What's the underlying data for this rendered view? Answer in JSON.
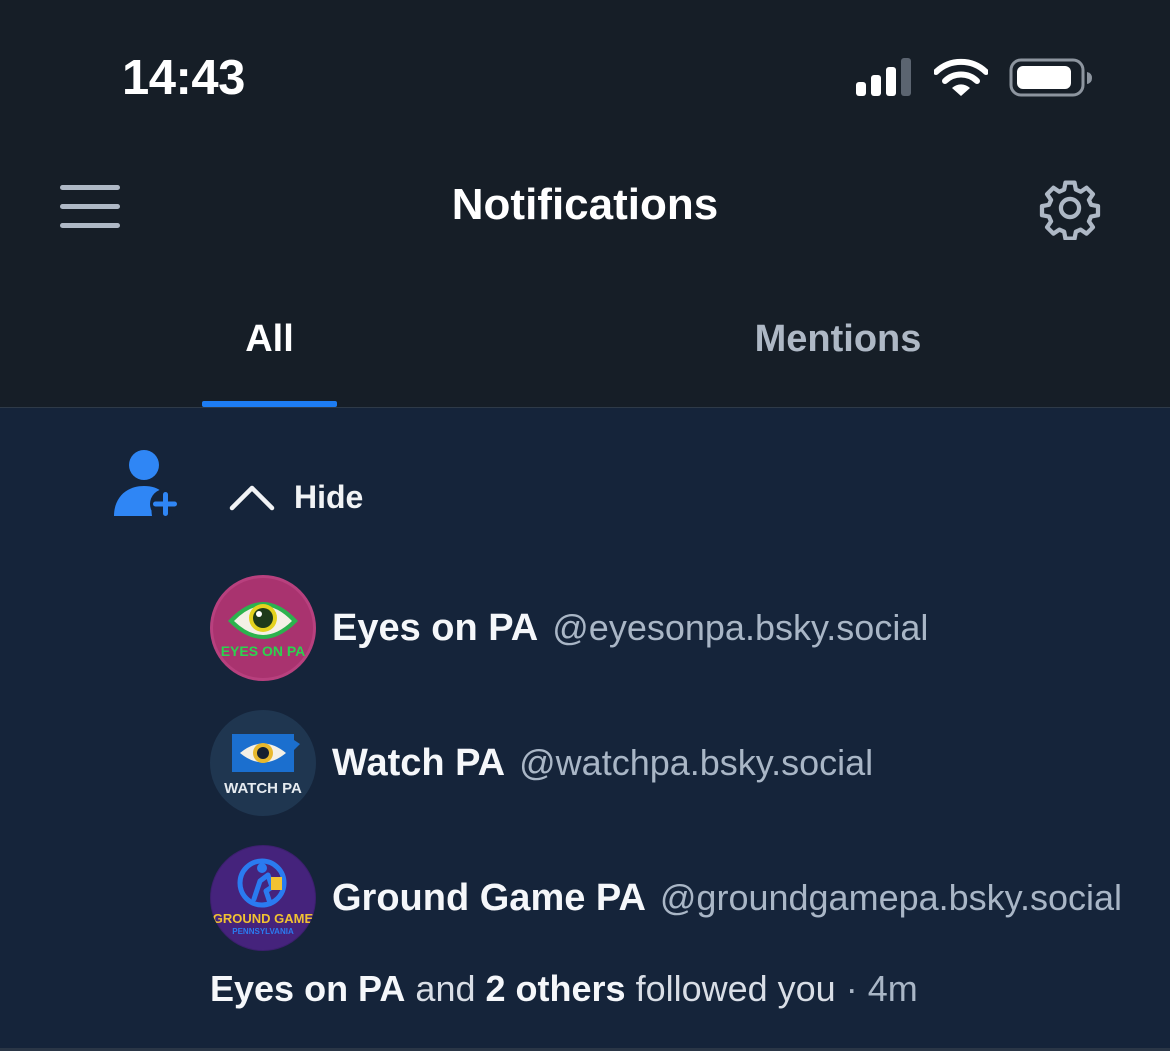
{
  "status_bar": {
    "time": "14:43"
  },
  "header": {
    "title": "Notifications"
  },
  "tabs": [
    {
      "label": "All",
      "active": true
    },
    {
      "label": "Mentions",
      "active": false
    }
  ],
  "notification": {
    "hide_label": "Hide",
    "followers": [
      {
        "name": "Eyes on PA",
        "handle": "@eyesonpa.bsky.social",
        "avatar_text": "EYES ON PA"
      },
      {
        "name": "Watch PA",
        "handle": "@watchpa.bsky.social",
        "avatar_text": "WATCH PA"
      },
      {
        "name": "Ground Game PA",
        "handle": "@groundgamepa.bsky.social",
        "avatar_text": "GROUND GAME",
        "avatar_subtext": "PENNSYLVANIA"
      }
    ],
    "summary": {
      "first_name": "Eyes on PA",
      "and": "and",
      "others": "2 others",
      "action": "followed you",
      "separator": "·",
      "time": "4m"
    }
  },
  "colors": {
    "accent": "#1d7cf2",
    "background": "#161e27",
    "card": "#15243a"
  }
}
